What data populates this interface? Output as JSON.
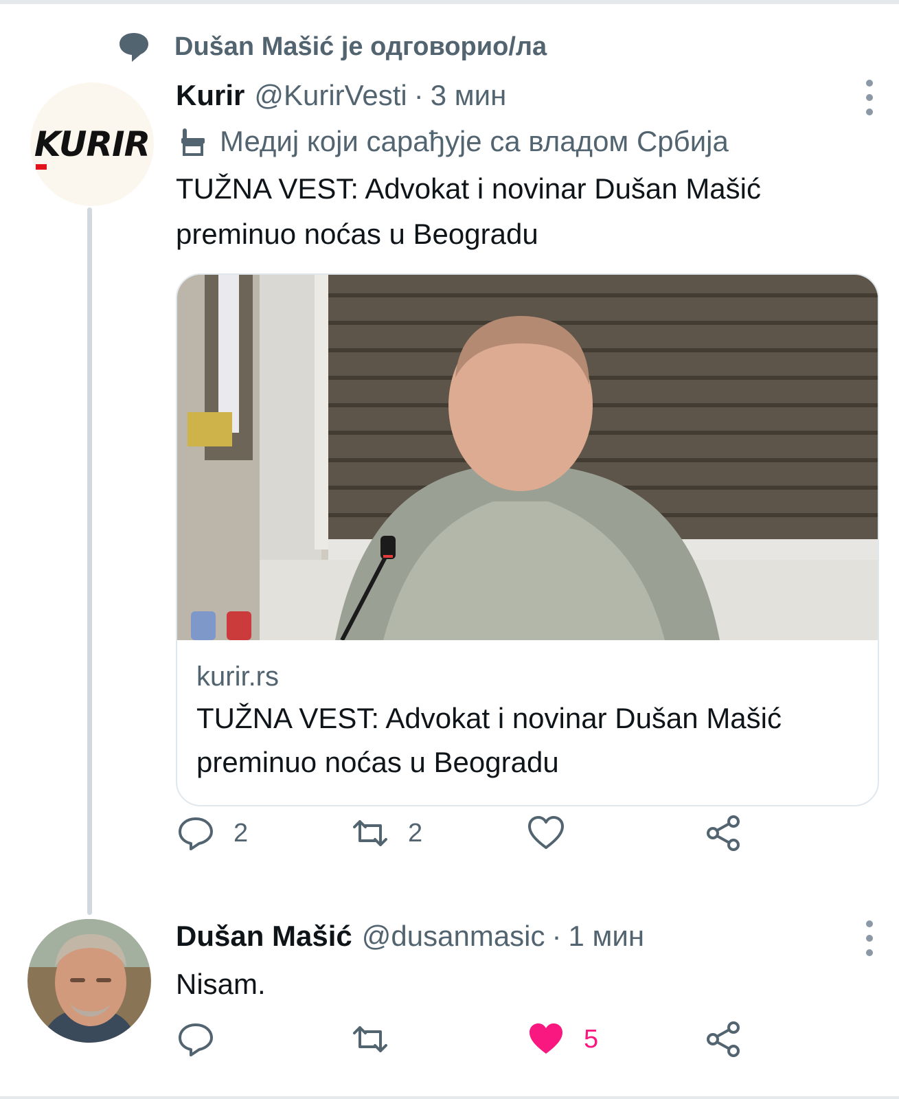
{
  "context": {
    "text": "Dušan Mašić je одговорио/ла",
    "icon": "speech-bubble-icon"
  },
  "tweet1": {
    "name": "Kurir",
    "handle": "@KurirVesti",
    "separator": "·",
    "time": "3 мин",
    "avatar_logo": "KURIR",
    "label": "Медиј који сарађује са владом Србија",
    "text": "TUŽNA VEST: Advokat i novinar Dušan Mašić preminuo noćas u Beogradu",
    "card": {
      "domain": "kurir.rs",
      "title": "TUŽNA VEST: Advokat i novinar Dušan Mašić preminuo noćas u Beogradu"
    },
    "actions": {
      "replies": "2",
      "retweets": "2",
      "likes": "",
      "share": ""
    }
  },
  "tweet2": {
    "name": "Dušan Mašić",
    "handle": "@dusanmasic",
    "separator": "·",
    "time": "1 мин",
    "text": "Nisam.",
    "actions": {
      "replies": "",
      "retweets": "",
      "likes": "5",
      "liked": true,
      "share": ""
    }
  },
  "colors": {
    "text": "#0f1419",
    "secondary": "#536471",
    "like": "#f91880",
    "thread_line": "#cfd9de",
    "border": "#e1e8ed"
  }
}
